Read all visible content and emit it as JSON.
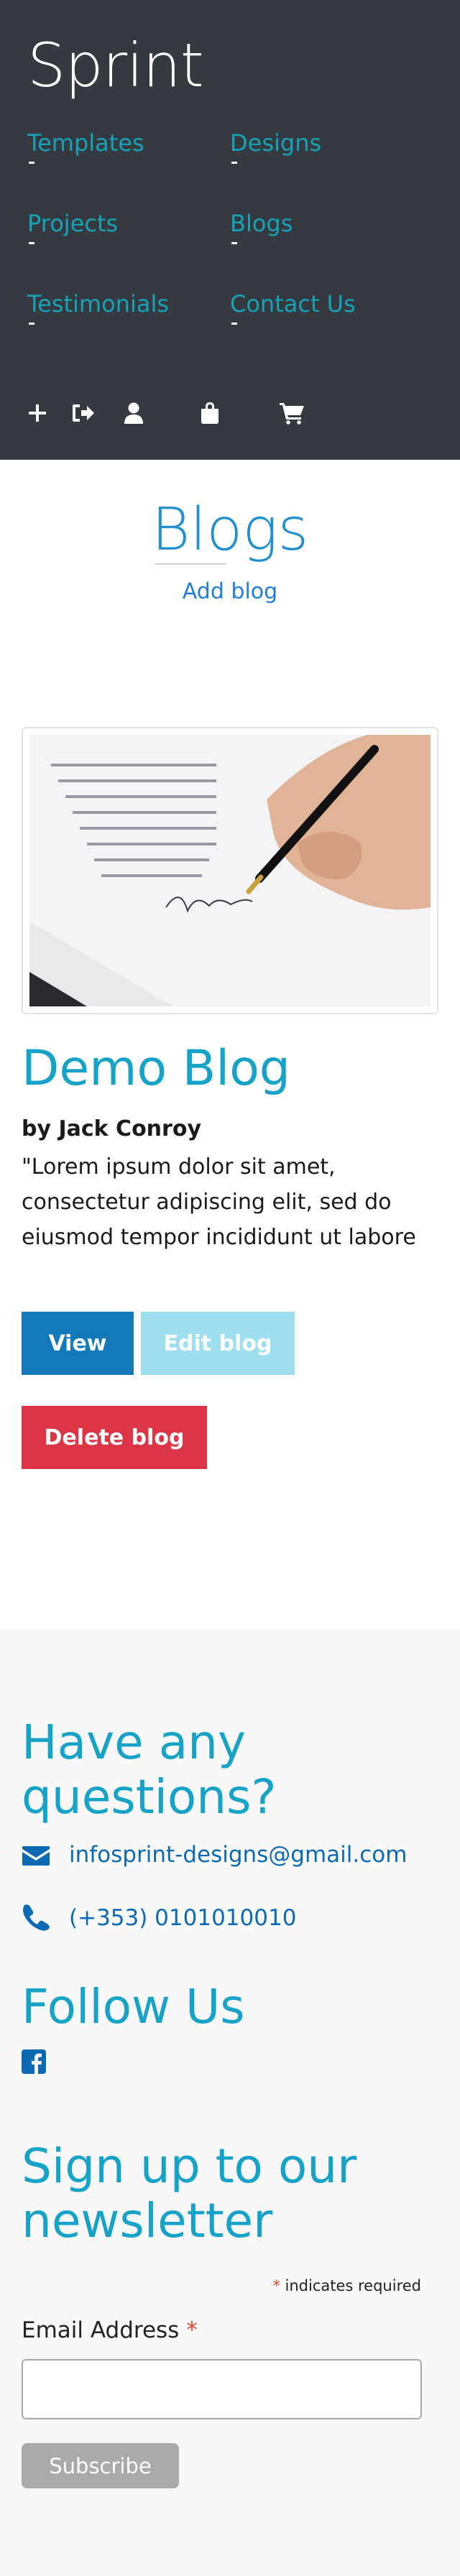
{
  "header": {
    "brand": "Sprint",
    "nav": [
      {
        "label": "Templates"
      },
      {
        "label": "Designs"
      },
      {
        "label": "Projects"
      },
      {
        "label": "Blogs"
      },
      {
        "label": "Testimonials"
      },
      {
        "label": "Contact Us"
      }
    ],
    "icons": [
      "plus-icon",
      "sign-out-icon",
      "user-icon",
      "shopping-bag-icon",
      "shopping-cart-icon"
    ]
  },
  "blogs": {
    "title": "Blogs",
    "add_link": "Add blog",
    "post": {
      "image": "hand-signing-document-photo",
      "title": "Demo Blog",
      "author": "by Jack Conroy",
      "excerpt": "\"Lorem ipsum dolor sit amet, consectetur adipiscing elit, sed do eiusmod tempor incididunt ut labore",
      "view_label": "View",
      "edit_label": "Edit blog",
      "delete_label": "Delete blog"
    }
  },
  "footer": {
    "questions_heading": "Have any questions?",
    "email": "infosprint-designs@gmail.com",
    "phone": "(+353) 0101010010",
    "follow_heading": "Follow Us",
    "social_icon": "facebook-square-icon",
    "newsletter_heading": "Sign up to our newsletter",
    "required_star": "*",
    "required_note": " indicates required",
    "email_label": "Email Address",
    "email_star": "*",
    "email_value": "",
    "subscribe_label": "Subscribe"
  },
  "colors": {
    "header_bg": "#343a40",
    "accent_teal": "#17a2b8",
    "link_blue": "#1f7ed8",
    "view_btn": "#1479b8",
    "edit_btn": "#9ddfee",
    "delete_btn": "#dc3545",
    "footer_bg": "#f8f8f8"
  }
}
